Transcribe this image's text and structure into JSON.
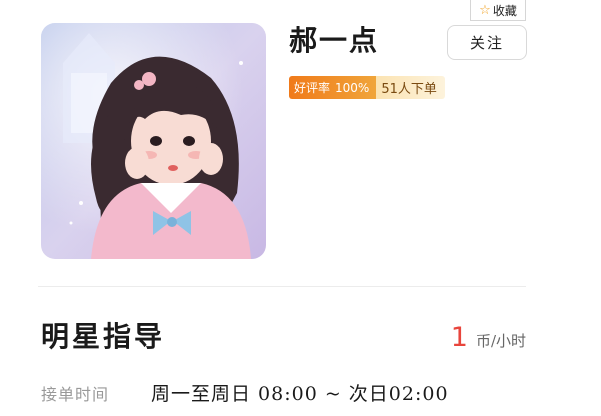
{
  "toolbar": {
    "collect_label": "收藏",
    "collect_icon": "star-outline-icon"
  },
  "profile": {
    "avatar_description_icon": "avatar-photo",
    "name": "郝一点",
    "follow_label": "关注",
    "rating_label": "好评率",
    "rating_value": "100%",
    "orders_text": "51人下单"
  },
  "service": {
    "title": "明星指导",
    "price_value": "1",
    "price_unit": "币/小时",
    "hours_label": "接单时间",
    "hours_value": "周一至周日  08:00 ~ 次日02:00"
  },
  "colors": {
    "accent_orange": "#f07a1a",
    "price_red": "#e8453c",
    "badge_bg": "#fbe3b2"
  }
}
